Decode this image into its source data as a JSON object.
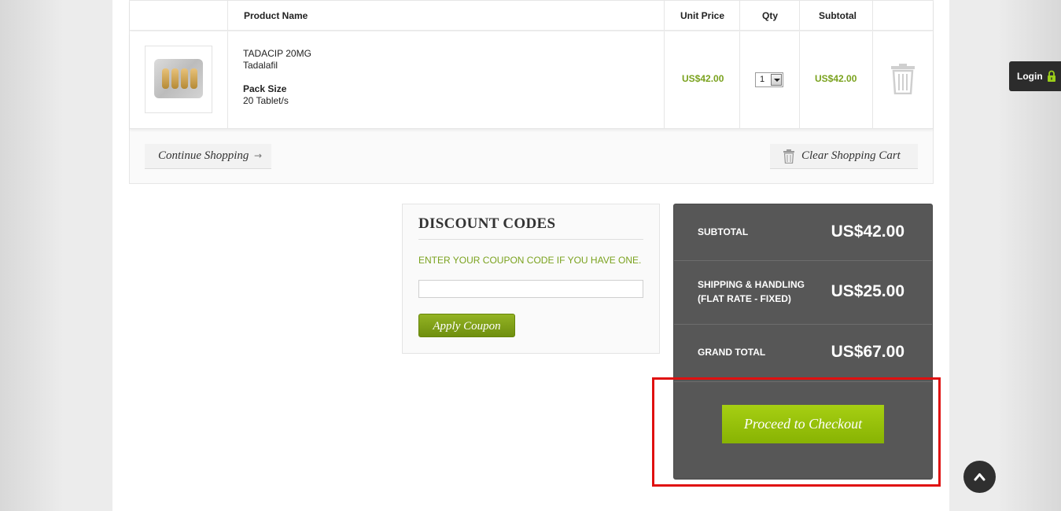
{
  "cart": {
    "headers": {
      "product_name": "Product Name",
      "unit_price": "Unit Price",
      "qty": "Qty",
      "subtotal": "Subtotal"
    },
    "items": [
      {
        "name": "TADACIP 20MG",
        "generic": "Tadalafil",
        "pack_size_label": "Pack Size",
        "pack_size_value": "20 Tablet/s",
        "unit_price": "US$42.00",
        "qty": "1",
        "subtotal": "US$42.00"
      }
    ],
    "continue_label": "Continue Shopping",
    "clear_label": "Clear Shopping Cart"
  },
  "discount": {
    "title": "DISCOUNT CODES",
    "hint": "ENTER YOUR COUPON CODE IF YOU HAVE ONE.",
    "input_value": "",
    "apply_label": "Apply Coupon"
  },
  "totals": {
    "subtotal_label": "SUBTOTAL",
    "subtotal_value": "US$42.00",
    "shipping_label_1": "SHIPPING & HANDLING",
    "shipping_label_2": "(FLAT RATE - FIXED)",
    "shipping_value": "US$25.00",
    "grand_label": "GRAND TOTAL",
    "grand_value": "US$67.00",
    "checkout_label": "Proceed to Checkout"
  },
  "login_label": "Login",
  "colors": {
    "accent_green": "#7aa21e",
    "checkout_green": "#98c10a",
    "totals_bg": "#575757",
    "highlight": "#e01010"
  }
}
